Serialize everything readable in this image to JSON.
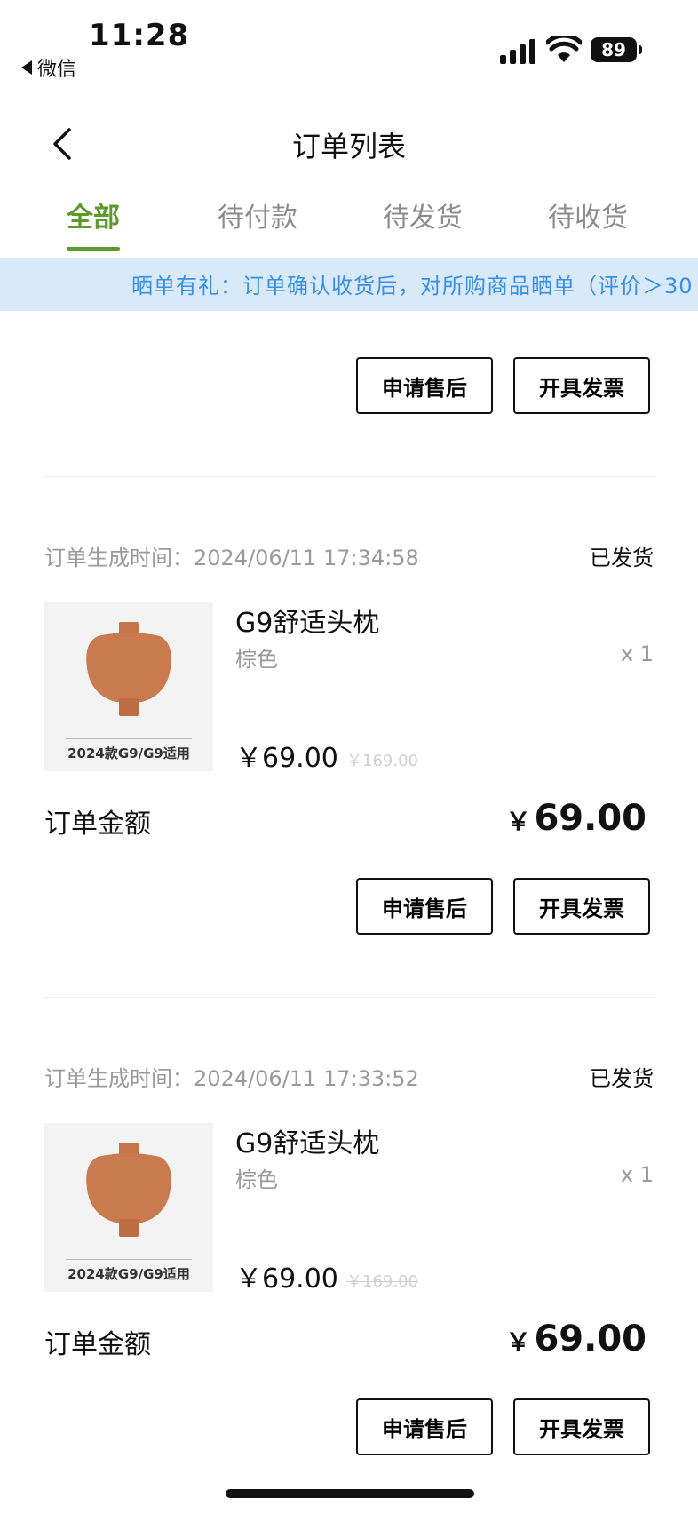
{
  "status_bar": {
    "time": "11:28",
    "back_app": "微信",
    "battery": "89"
  },
  "header": {
    "title": "订单列表"
  },
  "tabs": [
    {
      "label": "全部",
      "active": true
    },
    {
      "label": "待付款",
      "active": false
    },
    {
      "label": "待发货",
      "active": false
    },
    {
      "label": "待收货",
      "active": false
    }
  ],
  "banner": {
    "text": "晒单有礼：订单确认收货后，对所购商品晒单（评价＞30"
  },
  "orders": [
    {
      "buttons": {
        "after_sale": "申请售后",
        "invoice": "开具发票"
      }
    },
    {
      "created_label": "订单生成时间：",
      "created_time": "2024/06/11 17:34:58",
      "status": "已发货",
      "product": {
        "name": "G9舒适头枕",
        "variant": "棕色",
        "qty": "x 1",
        "price": "￥69.00",
        "original_price": "￥169.00",
        "image_caption": "2024款G9/G9适用"
      },
      "total_label": "订单金额",
      "total_currency": "￥",
      "total_amount": "69.00",
      "buttons": {
        "after_sale": "申请售后",
        "invoice": "开具发票"
      }
    },
    {
      "created_label": "订单生成时间：",
      "created_time": "2024/06/11 17:33:52",
      "status": "已发货",
      "product": {
        "name": "G9舒适头枕",
        "variant": "棕色",
        "qty": "x 1",
        "price": "￥69.00",
        "original_price": "￥169.00",
        "image_caption": "2024款G9/G9适用"
      },
      "total_label": "订单金额",
      "total_currency": "￥",
      "total_amount": "69.00",
      "buttons": {
        "after_sale": "申请售后",
        "invoice": "开具发票"
      }
    }
  ],
  "colors": {
    "accent": "#5c9a2c",
    "banner_bg": "#d8e9fa",
    "banner_text": "#3a8ee6",
    "pillow": "#c97a4e"
  }
}
